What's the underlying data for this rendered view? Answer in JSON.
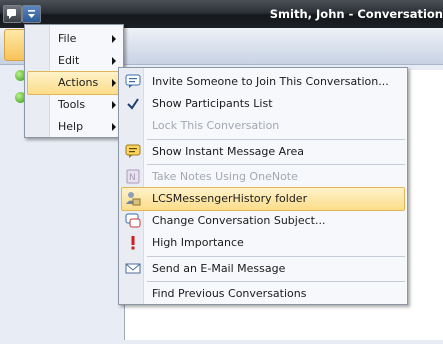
{
  "window": {
    "title": "Smith, John - Conversation"
  },
  "main_menu": [
    {
      "label": "File",
      "accel": "F"
    },
    {
      "label": "Edit",
      "accel": "E"
    },
    {
      "label": "Actions",
      "accel": "A"
    },
    {
      "label": "Tools",
      "accel": "T"
    },
    {
      "label": "Help",
      "accel": "H"
    }
  ],
  "actions_menu": [
    {
      "label": "Invite Someone to Join This Conversation...",
      "icon": "invite-icon",
      "enabled": true
    },
    {
      "label": "Show Participants List",
      "icon": "checkmark-icon",
      "enabled": true,
      "checked": true
    },
    {
      "label": "Lock This Conversation",
      "icon": "",
      "enabled": false
    },
    {
      "label": "Show Instant Message Area",
      "icon": "instant-message-icon",
      "enabled": true
    },
    {
      "label": "Take Notes Using OneNote",
      "icon": "onenote-icon",
      "enabled": false
    },
    {
      "label": "LCSMessengerHistory folder",
      "icon": "history-folder-icon",
      "enabled": true,
      "highlighted": true
    },
    {
      "label": "Change Conversation Subject...",
      "icon": "subject-icon",
      "enabled": true
    },
    {
      "label": "High Importance",
      "icon": "exclamation-icon",
      "enabled": true
    },
    {
      "label": "Send an E-Mail Message",
      "icon": "email-icon",
      "enabled": true
    },
    {
      "label": "Find Previous Conversations",
      "icon": "",
      "enabled": true
    }
  ],
  "colors": {
    "highlight": "#fbdd8a",
    "presence_online": "#2f9b12"
  }
}
